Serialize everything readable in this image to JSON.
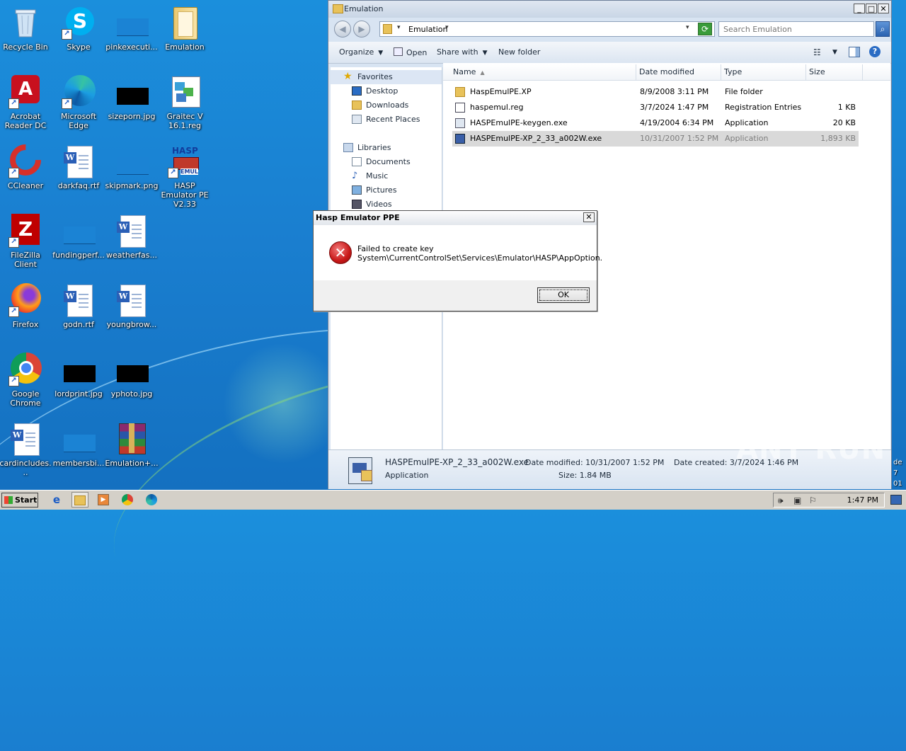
{
  "desktop": {
    "icons": [
      {
        "label": "Recycle Bin"
      },
      {
        "label": "Skype"
      },
      {
        "label": "pinkexecuti..."
      },
      {
        "label": "Emulation"
      },
      {
        "label": "Acrobat Reader DC"
      },
      {
        "label": "Microsoft Edge"
      },
      {
        "label": "sizeporn.jpg"
      },
      {
        "label": "Graitec V 16.1.reg"
      },
      {
        "label": "CCleaner"
      },
      {
        "label": "darkfaq.rtf"
      },
      {
        "label": "skipmark.png"
      },
      {
        "label": "HASP Emulator PE V2.33"
      },
      {
        "label": "FileZilla Client"
      },
      {
        "label": "fundingperf..."
      },
      {
        "label": "weatherfas..."
      },
      {
        "label": "Firefox"
      },
      {
        "label": "godn.rtf"
      },
      {
        "label": "youngbrow..."
      },
      {
        "label": "Google Chrome"
      },
      {
        "label": "lordprint.jpg"
      },
      {
        "label": "yphoto.jpg"
      },
      {
        "label": "cardincludes..."
      },
      {
        "label": "membersbi..."
      },
      {
        "label": "Emulation+..."
      }
    ],
    "watermark": "ANY RUN",
    "edge_text": [
      "de",
      "7",
      "01"
    ]
  },
  "explorer": {
    "title": "Emulation",
    "address": "Emulation",
    "search_placeholder": "Search Emulation",
    "toolbar": {
      "organize": "Organize",
      "open": "Open",
      "share_with": "Share with",
      "new_folder": "New folder"
    },
    "nav": {
      "favorites": "Favorites",
      "desktop": "Desktop",
      "downloads": "Downloads",
      "recent": "Recent Places",
      "libraries": "Libraries",
      "documents": "Documents",
      "music": "Music",
      "pictures": "Pictures",
      "videos": "Videos"
    },
    "columns": {
      "name": "Name",
      "date": "Date modified",
      "type": "Type",
      "size": "Size"
    },
    "files": [
      {
        "name": "HaspEmulPE.XP",
        "date": "8/9/2008 3:11 PM",
        "type": "File folder",
        "size": ""
      },
      {
        "name": "haspemul.reg",
        "date": "3/7/2024 1:47 PM",
        "type": "Registration Entries",
        "size": "1 KB"
      },
      {
        "name": "HASPEmulPE-keygen.exe",
        "date": "4/19/2004 6:34 PM",
        "type": "Application",
        "size": "20 KB"
      },
      {
        "name": "HASPEmulPE-XP_2_33_a002W.exe",
        "date": "10/31/2007 1:52 PM",
        "type": "Application",
        "size": "1,893 KB"
      }
    ],
    "details": {
      "filename": "HASPEmulPE-XP_2_33_a002W.exe",
      "type": "Application",
      "date_modified": "Date modified: 10/31/2007 1:52 PM",
      "size": "Size: 1.84 MB",
      "date_created": "Date created: 3/7/2024 1:46 PM"
    }
  },
  "dialog": {
    "title": "Hasp Emulator PPE",
    "message_line1": "Failed to create key",
    "message_line2": "System\\CurrentControlSet\\Services\\Emulator\\HASP\\AppOption.",
    "ok": "OK",
    "close": "✕"
  },
  "taskbar": {
    "start": "Start",
    "clock": "1:47 PM"
  }
}
